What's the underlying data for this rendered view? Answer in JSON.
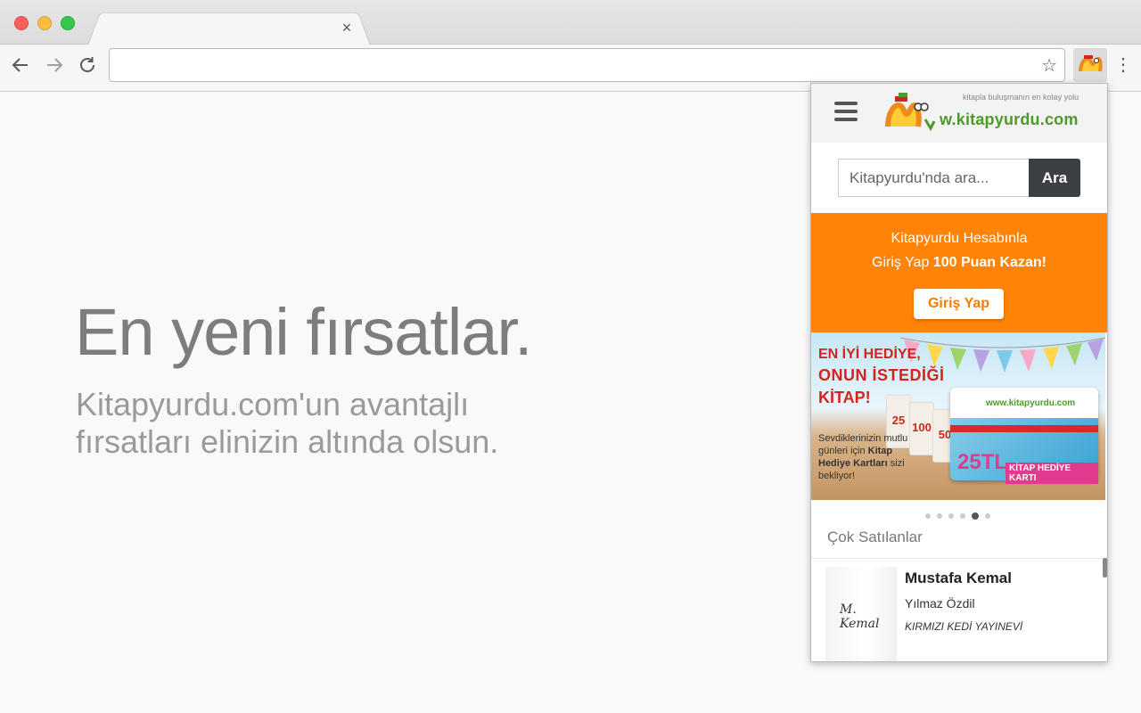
{
  "browser": {
    "tab_close": "×",
    "omnibox_value": "",
    "icons": {
      "back": "arrow-left-icon",
      "forward": "arrow-right-icon",
      "reload": "reload-icon",
      "bookmark": "star-icon",
      "extension": "kitapyurdu-extension-icon",
      "menu": "more-vert-icon"
    }
  },
  "page": {
    "hero_title": "En yeni fırsatlar.",
    "hero_subtitle": "Kitapyurdu.com'un avantajlı fırsatları elinizin altında olsun."
  },
  "popup": {
    "logo": {
      "tagline": "kitapla buluşmanın en kolay yolu",
      "text": "w.kitapyurdu.com"
    },
    "search": {
      "placeholder": "Kitapyurdu'nda ara...",
      "button_label": "Ara"
    },
    "promo": {
      "line1": "Kitapyurdu Hesabınla",
      "line2_prefix": "Giriş Yap ",
      "line2_bold": "100 Puan Kazan!",
      "button_label": "Giriş Yap",
      "color": "#ff8306"
    },
    "banner": {
      "headline1": "EN İYİ HEDİYE,",
      "headline2": "ONUN İSTEDİĞİ",
      "headline3": "KİTAP!",
      "text_part1": "Sevdiklerinizin mutlu günleri için ",
      "text_bold": "Kitap Hediye Kartları",
      "text_part2": " sizi bekliyor!",
      "card_logo": "www.kitapyurdu.com",
      "card_amount": "25TL",
      "card_label": "KİTAP HEDİYE KARTI",
      "mini_values": [
        "25",
        "100",
        "50"
      ]
    },
    "carousel": {
      "dot_count": 6,
      "active_index": 4
    },
    "bestsellers": {
      "title": "Çok Satılanlar",
      "items": [
        {
          "title": "Mustafa Kemal",
          "author": "Yılmaz Özdil",
          "publisher": "KIRMIZI KEDİ YAYINEVİ",
          "cover_signature": "M. Kemal"
        }
      ]
    }
  }
}
